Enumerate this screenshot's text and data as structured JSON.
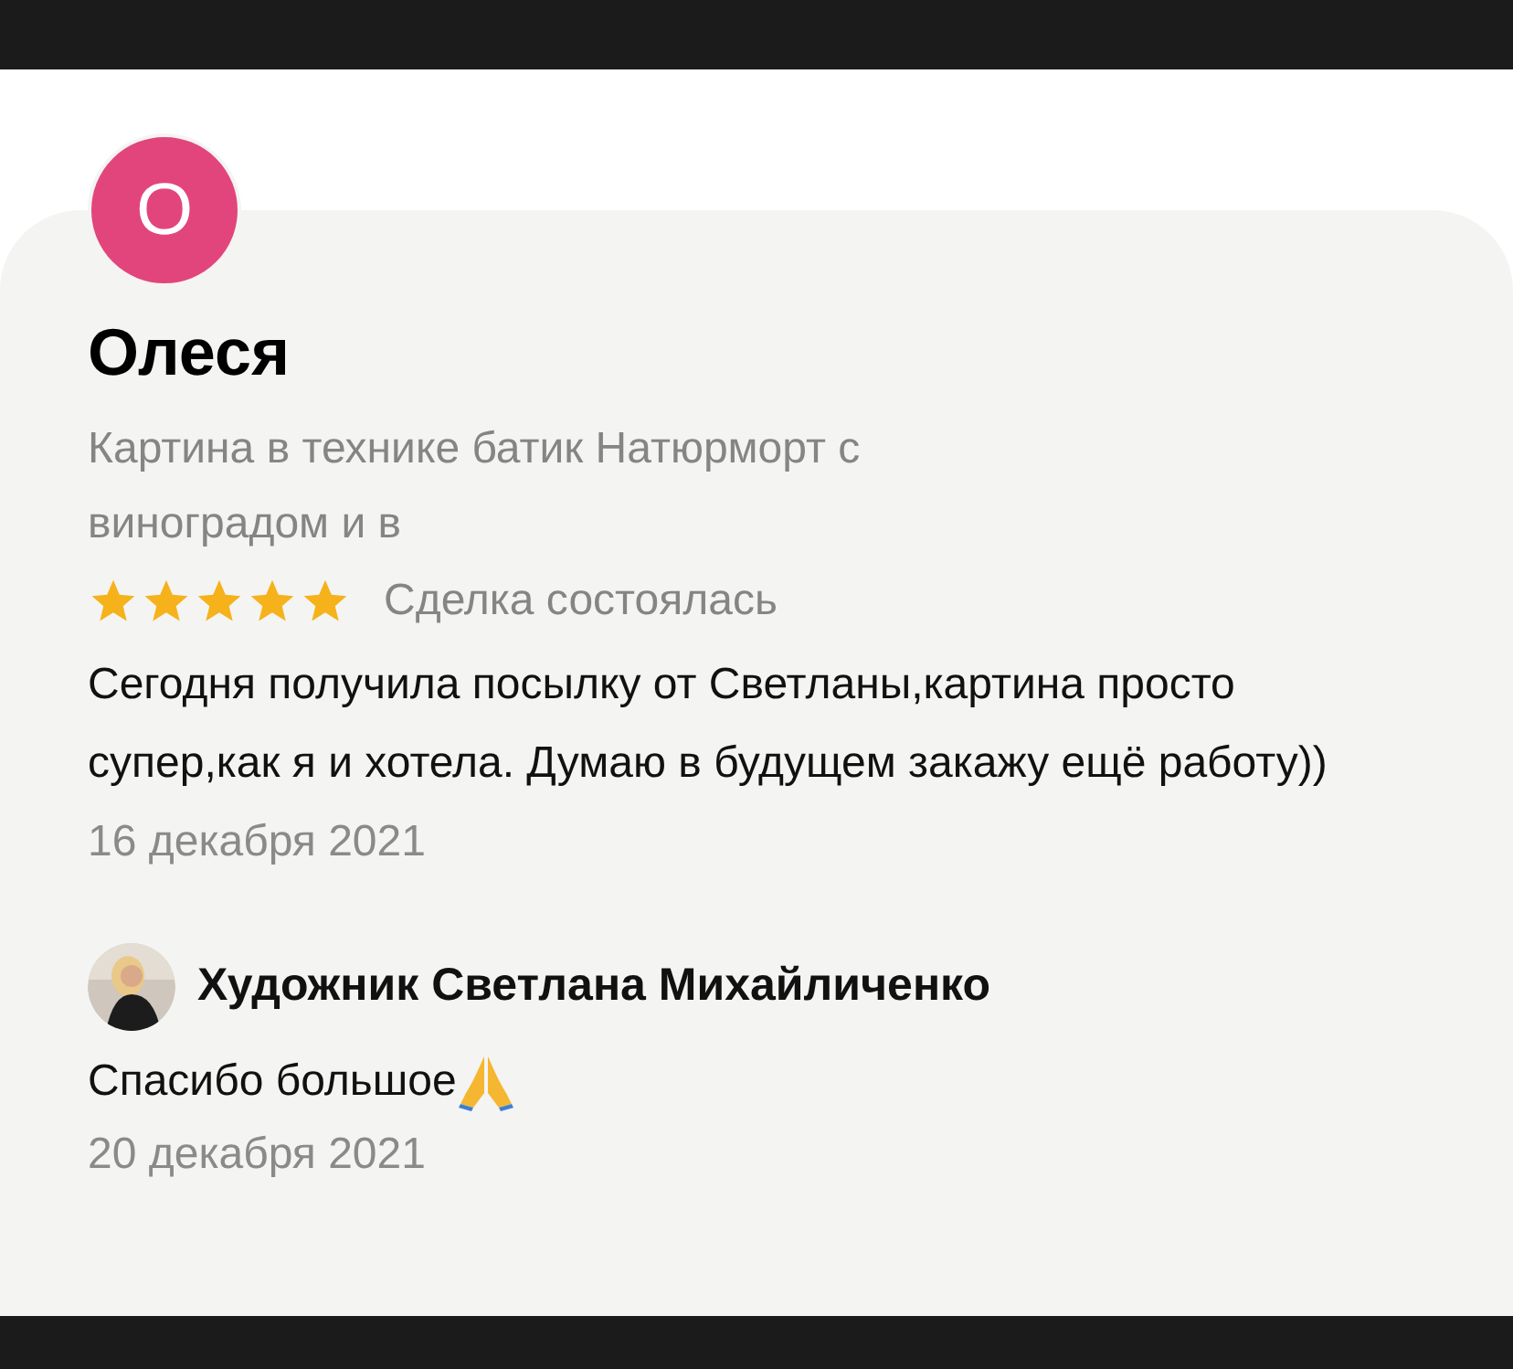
{
  "review": {
    "avatar_letter": "О",
    "author": "Олеся",
    "product": "Картина в технике батик Натюрморт с виноградом и в",
    "stars": 5,
    "status": "Сделка состоялась",
    "text": "Сегодня получила посылку от Светланы,картина просто супер,как я и хотела. Думаю в будущем закажу ещё работу))",
    "date": "16 декабря 2021"
  },
  "reply": {
    "author": "Художник Светлана Михайличенко",
    "text": "Спасибо большое",
    "date": "20 декабря 2021"
  }
}
